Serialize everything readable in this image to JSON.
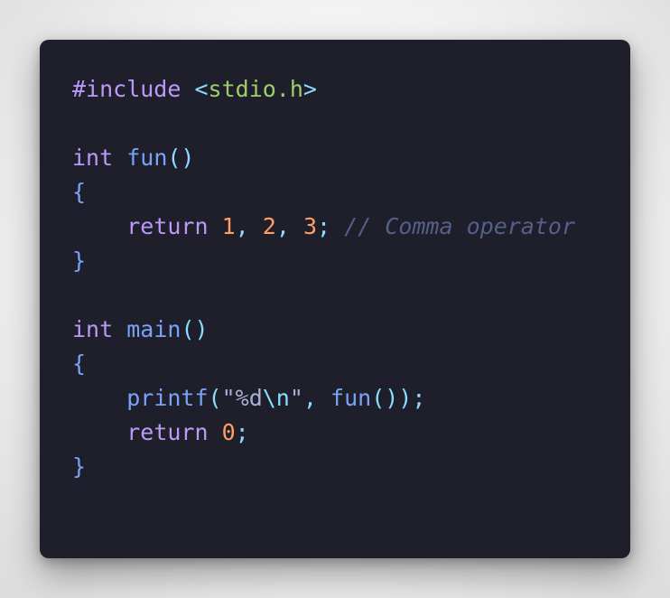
{
  "code": {
    "language": "c",
    "lines": [
      {
        "tokens": [
          {
            "t": "#include",
            "k": "kw-pre"
          },
          {
            "t": " ",
            "k": "plain"
          },
          {
            "t": "<",
            "k": "ang"
          },
          {
            "t": "stdio.h",
            "k": "hdr"
          },
          {
            "t": ">",
            "k": "ang"
          }
        ]
      },
      {
        "tokens": []
      },
      {
        "tokens": [
          {
            "t": "int",
            "k": "type"
          },
          {
            "t": " ",
            "k": "plain"
          },
          {
            "t": "fun",
            "k": "fn"
          },
          {
            "t": "()",
            "k": "punc"
          }
        ]
      },
      {
        "tokens": [
          {
            "t": "{",
            "k": "brace"
          }
        ]
      },
      {
        "tokens": [
          {
            "t": "    ",
            "k": "plain"
          },
          {
            "t": "return",
            "k": "kw"
          },
          {
            "t": " ",
            "k": "plain"
          },
          {
            "t": "1",
            "k": "num"
          },
          {
            "t": ", ",
            "k": "punc"
          },
          {
            "t": "2",
            "k": "num"
          },
          {
            "t": ", ",
            "k": "punc"
          },
          {
            "t": "3",
            "k": "num"
          },
          {
            "t": ";",
            "k": "punc"
          },
          {
            "t": " ",
            "k": "plain"
          },
          {
            "t": "// Comma operator",
            "k": "com"
          }
        ]
      },
      {
        "tokens": [
          {
            "t": "}",
            "k": "brace"
          }
        ]
      },
      {
        "tokens": []
      },
      {
        "tokens": [
          {
            "t": "int",
            "k": "type"
          },
          {
            "t": " ",
            "k": "plain"
          },
          {
            "t": "main",
            "k": "fn"
          },
          {
            "t": "()",
            "k": "punc"
          }
        ]
      },
      {
        "tokens": [
          {
            "t": "{",
            "k": "brace"
          }
        ]
      },
      {
        "tokens": [
          {
            "t": "    ",
            "k": "plain"
          },
          {
            "t": "printf",
            "k": "fn"
          },
          {
            "t": "(",
            "k": "punc"
          },
          {
            "t": "\"%d",
            "k": "str"
          },
          {
            "t": "\\n",
            "k": "esc"
          },
          {
            "t": "\"",
            "k": "str"
          },
          {
            "t": ", ",
            "k": "punc"
          },
          {
            "t": "fun",
            "k": "fn"
          },
          {
            "t": "());",
            "k": "punc"
          }
        ]
      },
      {
        "tokens": [
          {
            "t": "    ",
            "k": "plain"
          },
          {
            "t": "return",
            "k": "kw"
          },
          {
            "t": " ",
            "k": "plain"
          },
          {
            "t": "0",
            "k": "num"
          },
          {
            "t": ";",
            "k": "punc"
          }
        ]
      },
      {
        "tokens": [
          {
            "t": "}",
            "k": "brace"
          }
        ]
      }
    ]
  },
  "colors": {
    "card_background": "#1e1f2b",
    "keyword": "#bb9af7",
    "function": "#7aa2f7",
    "number": "#ff9e64",
    "header": "#9ece6a",
    "punctuation": "#89ddff",
    "comment": "#565f89",
    "text": "#a9b1d6"
  }
}
